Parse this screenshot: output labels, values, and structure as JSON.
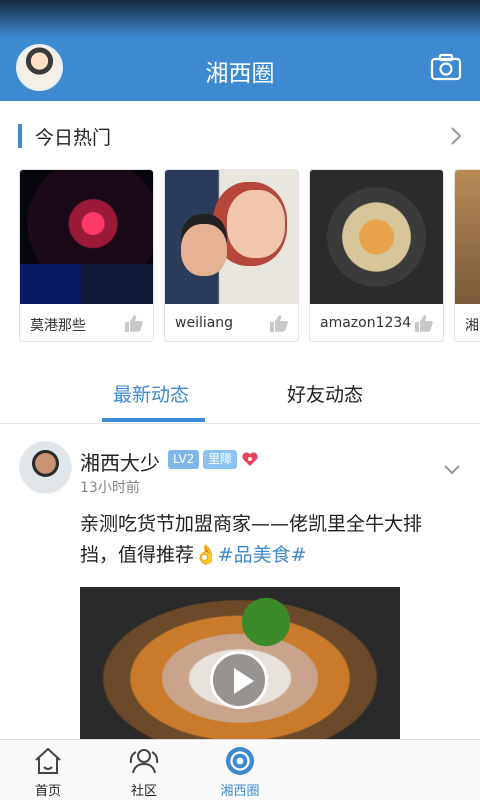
{
  "header": {
    "title": "湘西圈"
  },
  "hot_section": {
    "title": "今日热门",
    "cards": [
      {
        "label": "莫港那些"
      },
      {
        "label": "weiliang"
      },
      {
        "label": "amazon1234"
      },
      {
        "label": "湘"
      }
    ]
  },
  "tabs": [
    {
      "label": "最新动态",
      "active": true
    },
    {
      "label": "好友动态",
      "active": false
    }
  ],
  "post": {
    "author": "湘西大少",
    "level_badge": "LV2",
    "role_badge": "里障",
    "time": "13小时前",
    "text_line1": "亲测吃货节加盟商家——佬凯里全牛大排",
    "text_line2": "挡，值得推荐👌",
    "hashtag": "#品美食#"
  },
  "bottom_nav": [
    {
      "label": "首页",
      "icon": "home-icon",
      "active": false
    },
    {
      "label": "社区",
      "icon": "community-icon",
      "active": false
    },
    {
      "label": "湘西圈",
      "icon": "circle-icon",
      "active": true
    }
  ],
  "colors": {
    "accent": "#3d8ad1",
    "badge_level": "#7fb7ea",
    "heart": "#e8435a"
  }
}
